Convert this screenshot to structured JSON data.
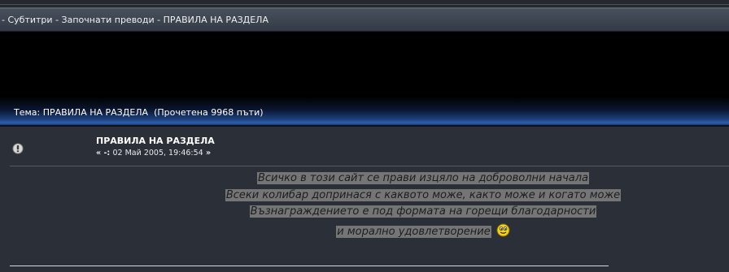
{
  "breadcrumb": {
    "prefix": "-",
    "items": [
      {
        "label": "Субтитри"
      },
      {
        "label": "Започнати преводи"
      },
      {
        "label": "ПРАВИЛА НА РАЗДЕЛА"
      }
    ],
    "separator": "-"
  },
  "topic": {
    "title_line": "Тема: ПРАВИЛА НА РАЗДЕЛА  (Прочетена 9968 пъти)"
  },
  "post": {
    "icon": "post-exclamation-icon",
    "title": "ПРАВИЛА НА РАЗДЕЛА",
    "meta_prefix": "« -:",
    "date": "02 Май 2005, 19:46:54",
    "meta_suffix": "»",
    "body_lines": [
      "Всичко в този сайт се прави изцяло на доброволни начала",
      "Всеки колибар допринася с каквото може, както може и когато може",
      "Възнаграждението е под формата на горещи благодарности",
      "и морално удовлетворение"
    ],
    "emoticon": "smiley-icon"
  },
  "colors": {
    "page_bg": "#2b3038",
    "banner_blue": "#2b5fae",
    "text_highlight": "#757575"
  }
}
